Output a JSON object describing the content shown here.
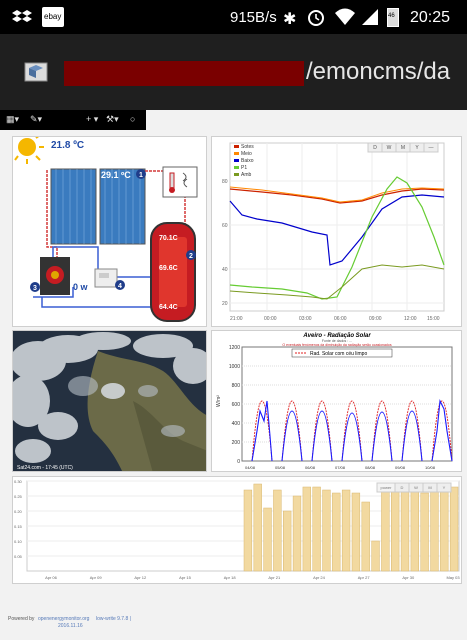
{
  "status_bar": {
    "network_speed": "915B/s",
    "battery_level": "46",
    "time": "20:25",
    "notif_ebay": "ebay"
  },
  "browser": {
    "url_visible": "/emoncms/da"
  },
  "menu_bar": {
    "items": [
      "▾",
      "▾",
      "+ ▾",
      "▾",
      "○"
    ]
  },
  "solar_panel": {
    "outdoor_temp": "21.8 ºC",
    "collector_temp": "29.1 ºC",
    "tank_top": "70.1C",
    "tank_mid": "69.6C",
    "tank_bottom": "64.4C",
    "pump_power": "0 w",
    "markers": [
      "1",
      "2",
      "3",
      "4"
    ]
  },
  "temps_chart": {
    "legend": [
      "Sotes",
      "Meio",
      "Baixo",
      "P1",
      "Amb"
    ],
    "buttons": [
      "D",
      "W",
      "M",
      "Y",
      "—"
    ],
    "y_ticks": [
      "80",
      "60",
      "40",
      "20"
    ],
    "x_ticks": [
      "21:00",
      "00:00",
      "03:00",
      "06:00",
      "09:00",
      "12:00",
      "15:00"
    ],
    "colors": {
      "sotes": "#cc2200",
      "meio": "#ff8800",
      "baixo": "#0000cc",
      "p1": "#66cc33",
      "amb": "#7a9a20"
    }
  },
  "satellite": {
    "caption": "Sat24.com - 17:45 (UTC)"
  },
  "radiation_chart": {
    "title": "Aveiro - Radiação Solar",
    "subtitle": "Fonte de dados : ... ",
    "note": "O eventuais fenómenos da diminuição da radiação serão ocasionados",
    "legend": "Rad. Solar com céu limpo",
    "ylabel": "W/m²",
    "y_ticks": [
      "1200",
      "1000",
      "800",
      "600",
      "400",
      "200",
      "0"
    ],
    "x_labels": [
      "04/08",
      "05/08",
      "06/08",
      "07/08",
      "08/08",
      "09/08",
      "10/08"
    ]
  },
  "bar_chart": {
    "y_ticks": [
      "0.30",
      "0.25",
      "0.20",
      "0.15",
      "0.10",
      "0.05"
    ],
    "x_ticks": [
      "Apr 06",
      "Apr 09",
      "Apr 12",
      "Apr 15",
      "Apr 18",
      "Apr 21",
      "Apr 24",
      "Apr 27",
      "Apr 30",
      "May 03"
    ],
    "buttons": [
      "power",
      "D",
      "W",
      "M",
      "Y"
    ],
    "bar_color": "#f2d9a0",
    "values": [
      0,
      0,
      0,
      0,
      0,
      0,
      0,
      0,
      0,
      0,
      0,
      0,
      0,
      0,
      0,
      0,
      0,
      0,
      0,
      0,
      0,
      0,
      0.27,
      0.29,
      0.21,
      0.27,
      0.2,
      0.25,
      0.28,
      0.28,
      0.27,
      0.26,
      0.27,
      0.26,
      0.23,
      0.1,
      0.27,
      0.29,
      0.29,
      0.27,
      0.26,
      0.29,
      0.28,
      0.28
    ]
  },
  "footer": {
    "powered_by": "Powered by",
    "link1": "openenergymonitor.org",
    "link2": "low-write 9.7.8 |",
    "date": "2016.11.16"
  }
}
